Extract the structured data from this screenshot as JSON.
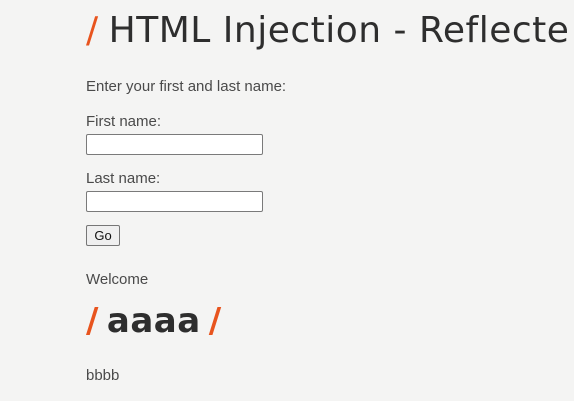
{
  "header": {
    "slash": "/",
    "title": "HTML Injection - Reflecte"
  },
  "form": {
    "intro": "Enter your first and last name:",
    "first_name_label": "First name:",
    "first_name_value": "",
    "last_name_label": "Last name:",
    "last_name_value": "",
    "submit_label": "Go"
  },
  "result": {
    "welcome": "Welcome",
    "slash_left": "/",
    "first_name": "aaaa",
    "slash_right": "/",
    "last_name": "bbbb"
  },
  "colors": {
    "accent": "#e8541e",
    "background": "#f4f4f3",
    "text": "#4a4a4a"
  }
}
